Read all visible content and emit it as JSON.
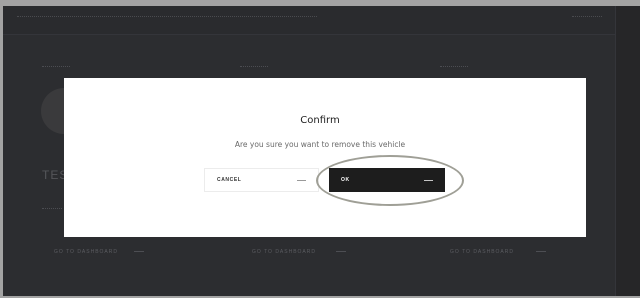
{
  "background": {
    "vehicle_title": "TES",
    "links": [
      "GO TO DASHBOARD",
      "GO TO DASHBOARD",
      "GO TO DASHBOARD"
    ]
  },
  "dialog": {
    "title": "Confirm",
    "message": "Are you sure you want to remove this vehicle",
    "cancel_label": "CANCEL",
    "ok_label": "OK"
  },
  "colors": {
    "backdrop": "#2c2d30",
    "dialog_bg": "#ffffff",
    "ok_button": "#1d1d1d",
    "highlight_ring": "#9f9f96"
  }
}
